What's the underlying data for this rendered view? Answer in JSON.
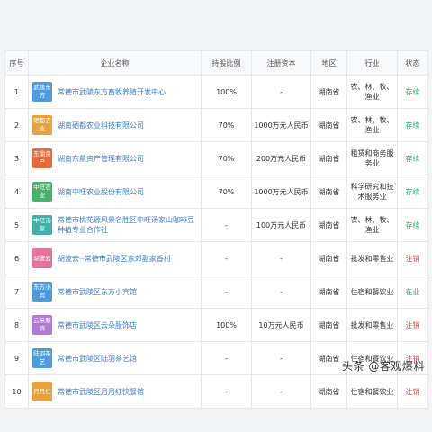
{
  "table": {
    "headers": [
      "序号",
      "企业名称",
      "持股比例",
      "注册资本",
      "地区",
      "行业",
      "状态"
    ],
    "rows": [
      {
        "no": "1",
        "logo": "武陵东方",
        "logo_color": "#4f9be0",
        "name": "常德市武陵东方畜牧养殖开发中心",
        "share": "100%",
        "capital": "-",
        "region": "湖南省",
        "industry": "农、林、牧、渔业",
        "status": "存续",
        "status_color": "#2eaf6a"
      },
      {
        "no": "2",
        "logo": "硒都农业",
        "logo_color": "#e6a23c",
        "name": "湖南硒都农业科技有限公司",
        "share": "70%",
        "capital": "1000万元人民币",
        "region": "湖南省",
        "industry": "农、林、牧、渔业",
        "status": "存续",
        "status_color": "#2eaf6a"
      },
      {
        "no": "3",
        "logo": "东鼎资产",
        "logo_color": "#e8693a",
        "name": "湖南东鼎资产管理有限公司",
        "share": "70%",
        "capital": "200万元人民币",
        "region": "湖南省",
        "industry": "租赁和商务服务业",
        "status": "存续",
        "status_color": "#2eaf6a"
      },
      {
        "no": "4",
        "logo": "中旺农业",
        "logo_color": "#4bb06b",
        "name": "湖南中旺农业股份有限公司",
        "share": "70%",
        "capital": "1000万元人民币",
        "region": "湖南省",
        "industry": "科学研究和技术服务业",
        "status": "存续",
        "status_color": "#2eaf6a"
      },
      {
        "no": "5",
        "logo": "中旺汤家",
        "logo_color": "#3fb1a8",
        "name": "常德市桃花源风景名胜区中旺汤家山咖啡豆种植专业合作社",
        "share": "-",
        "capital": "100万元人民币",
        "region": "湖南省",
        "industry": "农、林、牧、渔业",
        "status": "存续",
        "status_color": "#2eaf6a"
      },
      {
        "no": "6",
        "logo": "胡波云",
        "logo_color": "#e5739a",
        "name": "胡波云--常德市武陵区东郊副家香村",
        "share": "-",
        "capital": "-",
        "region": "湖南省",
        "industry": "批发和零售业",
        "status": "注销",
        "status_color": "#e5484d"
      },
      {
        "no": "7",
        "logo": "东方小宾",
        "logo_color": "#4f9be0",
        "name": "常德市武陵区东方小宾馆",
        "share": "-",
        "capital": "-",
        "region": "湖南省",
        "industry": "住宿和餐饮业",
        "status": "在业",
        "status_color": "#2eaf6a"
      },
      {
        "no": "8",
        "logo": "云朵服饰",
        "logo_color": "#b07ad6",
        "name": "常德市武陵区云朵服饰店",
        "share": "100%",
        "capital": "10万元人民币",
        "region": "湖南省",
        "industry": "批发和零售业",
        "status": "注销",
        "status_color": "#e5484d"
      },
      {
        "no": "9",
        "logo": "陆羽茶艺",
        "logo_color": "#4f9be0",
        "name": "常德市武陵区陆羽茶艺馆",
        "share": "-",
        "capital": "-",
        "region": "湖南省",
        "industry": "住宿和餐饮业",
        "status": "注销",
        "status_color": "#e5484d"
      },
      {
        "no": "10",
        "logo": "月月红",
        "logo_color": "#e6a23c",
        "name": "常德市武陵区月月红快餐馆",
        "share": "-",
        "capital": "-",
        "region": "湖南省",
        "industry": "住宿和餐饮业",
        "status": "注销",
        "status_color": "#e5484d"
      }
    ]
  },
  "watermark": "头条 @客观爆料"
}
